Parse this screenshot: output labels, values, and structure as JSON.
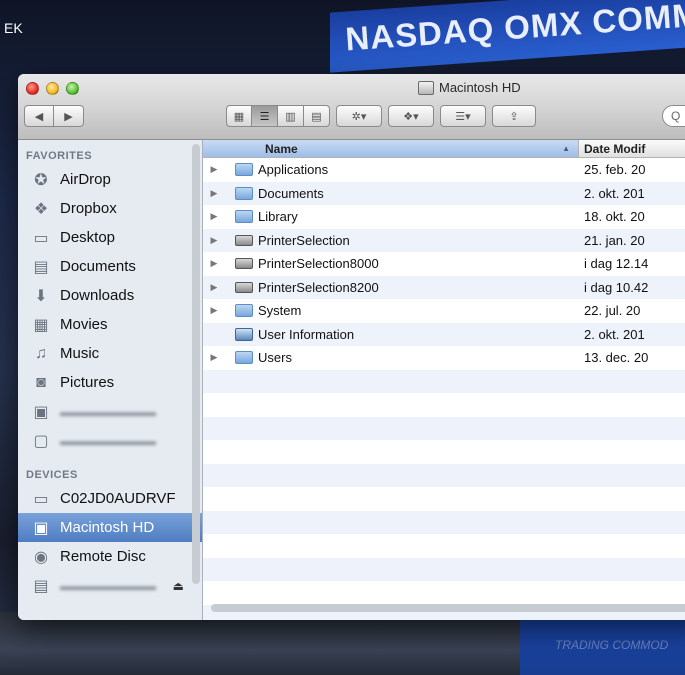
{
  "desktop": {
    "banner_top": "NASDAQ OMX COMMODI",
    "banner_bottom": "TRADING COMMOD",
    "corner_text": "EK"
  },
  "window": {
    "title": "Macintosh HD",
    "nav": {
      "back_glyph": "◀",
      "forward_glyph": "▶"
    },
    "views": [
      "icon-view",
      "list-view",
      "column-view",
      "coverflow-view"
    ],
    "action_glyph": "✲▾",
    "dropbox_glyph": "❖▾",
    "arrange_glyph": "☰▾",
    "share_glyph": "⇪",
    "search_glyph": "Q"
  },
  "sidebar": {
    "favorites_heading": "FAVORITES",
    "favorites": [
      {
        "label": "AirDrop",
        "icon": "airdrop-icon",
        "glyph": "✪"
      },
      {
        "label": "Dropbox",
        "icon": "dropbox-icon",
        "glyph": "❖"
      },
      {
        "label": "Desktop",
        "icon": "desktop-icon",
        "glyph": "▭"
      },
      {
        "label": "Documents",
        "icon": "documents-icon",
        "glyph": "▤"
      },
      {
        "label": "Downloads",
        "icon": "downloads-icon",
        "glyph": "⬇"
      },
      {
        "label": "Movies",
        "icon": "movies-icon",
        "glyph": "▦"
      },
      {
        "label": "Music",
        "icon": "music-icon",
        "glyph": "♫"
      },
      {
        "label": "Pictures",
        "icon": "pictures-icon",
        "glyph": "◙"
      },
      {
        "label": "",
        "icon": "blurred-folder-icon",
        "glyph": "▣"
      },
      {
        "label": "",
        "icon": "blurred-file-icon",
        "glyph": "▢"
      }
    ],
    "devices_heading": "DEVICES",
    "devices": [
      {
        "label": "C02JD0AUDRVF",
        "icon": "laptop-icon",
        "glyph": "▭"
      },
      {
        "label": "Macintosh HD",
        "icon": "hard-drive-icon",
        "glyph": "▣",
        "selected": true
      },
      {
        "label": "Remote Disc",
        "icon": "disc-icon",
        "glyph": "◉"
      },
      {
        "label": "",
        "icon": "blurred-drive-icon",
        "glyph": "▤",
        "eject_glyph": "⏏"
      }
    ]
  },
  "columns": {
    "name": "Name",
    "date": "Date Modif"
  },
  "files": [
    {
      "name": "Applications",
      "date": "25. feb. 20",
      "kind": "folder",
      "expandable": true
    },
    {
      "name": "Documents",
      "date": "2. okt. 201",
      "kind": "folder",
      "expandable": true
    },
    {
      "name": "Library",
      "date": "18. okt. 20",
      "kind": "folder",
      "expandable": true
    },
    {
      "name": "PrinterSelection",
      "date": "21. jan. 20",
      "kind": "printer",
      "expandable": true
    },
    {
      "name": "PrinterSelection8000",
      "date": "i dag 12.14",
      "kind": "printer",
      "expandable": true
    },
    {
      "name": "PrinterSelection8200",
      "date": "i dag 10.42",
      "kind": "printer",
      "expandable": true
    },
    {
      "name": "System",
      "date": "22. jul. 20",
      "kind": "folder",
      "expandable": true
    },
    {
      "name": "User Information",
      "date": "2. okt. 201",
      "kind": "doc",
      "expandable": false
    },
    {
      "name": "Users",
      "date": "13. dec. 20",
      "kind": "folder",
      "expandable": true
    }
  ]
}
